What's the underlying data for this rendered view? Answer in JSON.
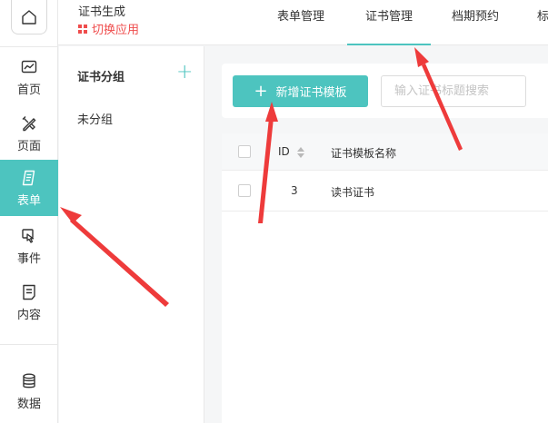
{
  "header": {
    "app_title": "证书生成",
    "switch_app": "切换应用",
    "tabs": [
      {
        "label": "表单管理"
      },
      {
        "label": "证书管理",
        "active": true
      },
      {
        "label": "档期预约"
      },
      {
        "label": "标"
      }
    ]
  },
  "sidebar": {
    "items": [
      {
        "label": "首页",
        "icon": "chart-icon"
      },
      {
        "label": "页面",
        "icon": "pen-ruler-icon"
      },
      {
        "label": "表单",
        "icon": "form-icon",
        "active": true
      },
      {
        "label": "事件",
        "icon": "touch-icon"
      },
      {
        "label": "内容",
        "icon": "document-icon"
      },
      {
        "label": "数据",
        "icon": "database-icon"
      }
    ]
  },
  "group_panel": {
    "title": "证书分组",
    "items": [
      {
        "label": "未分组"
      }
    ]
  },
  "toolbar": {
    "new_button": "新增证书模板",
    "search_placeholder": "输入证书标题搜索"
  },
  "table": {
    "columns": [
      "ID",
      "证书模板名称"
    ],
    "rows": [
      {
        "id": "3",
        "name": "读书证书"
      }
    ]
  },
  "colors": {
    "accent": "#4dc4bf",
    "switch_app": "#ef4d4d",
    "annotation_arrow": "#ee3b3b"
  }
}
